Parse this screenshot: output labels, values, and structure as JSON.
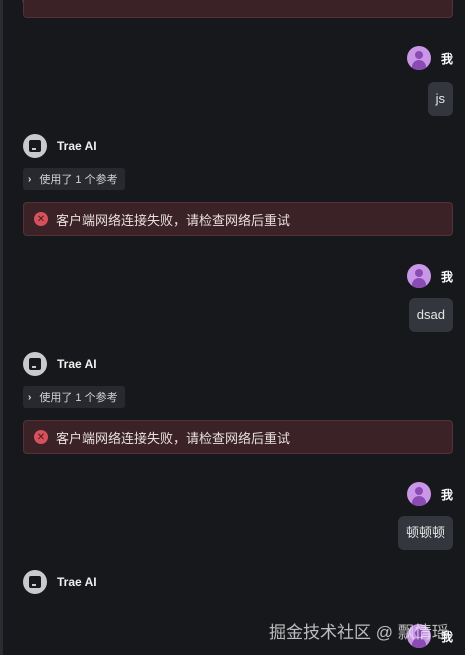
{
  "user_name": "我",
  "ai_name": "Trae AI",
  "reference_label": "使用了 1 个参考",
  "error_text": "客户端网络连接失败，请检查网络后重试",
  "messages": [
    {
      "user_text": "js"
    },
    {
      "user_text": "dsad"
    },
    {
      "user_text": "顿顿顿"
    }
  ],
  "watermark": "掘金技术社区 @ 飘情瑶",
  "colors": {
    "background": "#17181c",
    "error_bg": "#3a2227",
    "user_avatar": "#c996e8",
    "bubble": "#34363d"
  }
}
